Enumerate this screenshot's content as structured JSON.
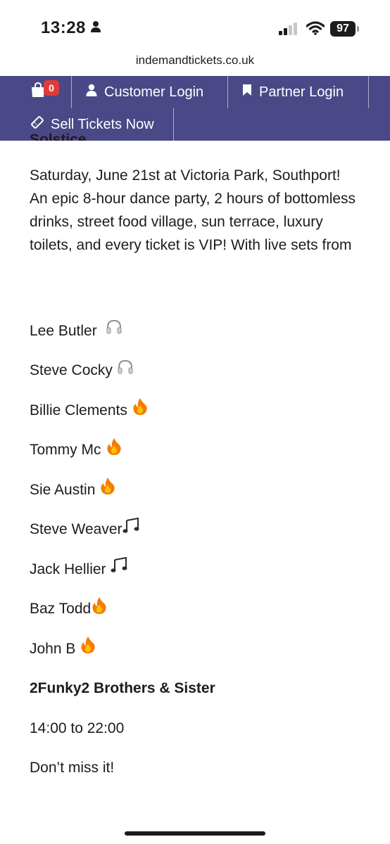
{
  "status_bar": {
    "time": "13:28",
    "battery": "97"
  },
  "browser": {
    "url": "indemandtickets.co.uk"
  },
  "nav": {
    "cart_count": "0",
    "customer_login": "Customer Login",
    "partner_login": "Partner Login",
    "sell_tickets": "Sell Tickets Now"
  },
  "event": {
    "cut_heading": "Solstice",
    "description": "Saturday, June 21st at Victoria Park, Southport! An epic 8-hour dance party, 2 hours of bottomless drinks, street food village, sun terrace, luxury toilets, and every ticket is VIP! With live sets from",
    "lineup": [
      {
        "name": "Lee Butler ",
        "emoji": "headphones-icon"
      },
      {
        "name": "Steve Cocky",
        "emoji": "headphones-icon"
      },
      {
        "name": "Billie Clements",
        "emoji": "fire-icon"
      },
      {
        "name": "Tommy Mc",
        "emoji": "fire-icon"
      },
      {
        "name": "Sie Austin",
        "emoji": "fire-icon"
      },
      {
        "name": "Steve Weaver",
        "emoji": "music-notes-icon"
      },
      {
        "name": "Jack Hellier",
        "emoji": "music-notes-icon"
      },
      {
        "name": "Baz Todd",
        "emoji": "fire-icon"
      },
      {
        "name": "John B",
        "emoji": "fire-icon"
      }
    ],
    "headliner": "2Funky2 Brothers & Sister",
    "times": "14:00 to 22:00",
    "cta": "Don’t miss it!"
  },
  "colors": {
    "nav_bg": "#4a4886",
    "badge": "#e03a3a",
    "text": "#1c1c1e"
  }
}
